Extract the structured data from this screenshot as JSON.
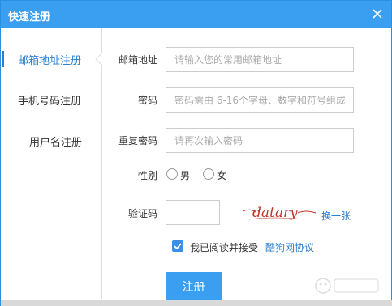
{
  "dialog": {
    "title": "快速注册"
  },
  "sidebar": {
    "items": [
      {
        "label": "邮箱地址注册",
        "active": true
      },
      {
        "label": "手机号码注册",
        "active": false
      },
      {
        "label": "用户名注册",
        "active": false
      }
    ]
  },
  "form": {
    "email": {
      "label": "邮箱地址",
      "placeholder": "请输入您的常用邮箱地址",
      "value": ""
    },
    "password": {
      "label": "密码",
      "placeholder": "密码需由 6-16个字母、数字和符号组成",
      "value": ""
    },
    "confirm": {
      "label": "重复密码",
      "placeholder": "请再次输入密码",
      "value": ""
    },
    "gender": {
      "label": "性别",
      "options": [
        "男",
        "女"
      ]
    },
    "captcha": {
      "label": "验证码",
      "value": "",
      "image_text": "datary",
      "refresh_label": "换一张"
    },
    "agreement": {
      "text": "我已阅读并接受",
      "link_label": "酷狗网协议",
      "checked": true
    },
    "submit_label": "注册"
  },
  "colors": {
    "accent": "#3a9ff0",
    "link": "#2a7fd0",
    "captcha_text": "#c0342a"
  }
}
